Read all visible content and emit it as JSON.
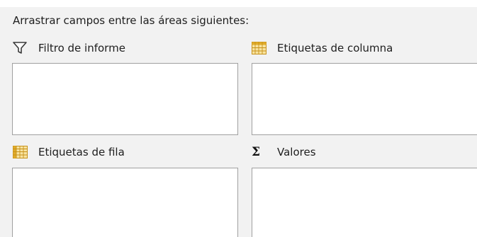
{
  "instruction": "Arrastrar campos entre las áreas siguientes:",
  "areas": {
    "report_filter": {
      "label": "Filtro de informe",
      "icon": "filter-icon"
    },
    "column_labels": {
      "label": "Etiquetas de columna",
      "icon": "table-grid-icon"
    },
    "row_labels": {
      "label": "Etiquetas de fila",
      "icon": "table-grid-icon"
    },
    "values": {
      "label": "Valores",
      "icon": "sigma-icon",
      "glyph": "Σ"
    }
  },
  "colors": {
    "panel_background": "#f2f2f2",
    "box_background": "#ffffff",
    "box_border": "#a0a0a0",
    "grid_icon": "#d9a521"
  }
}
